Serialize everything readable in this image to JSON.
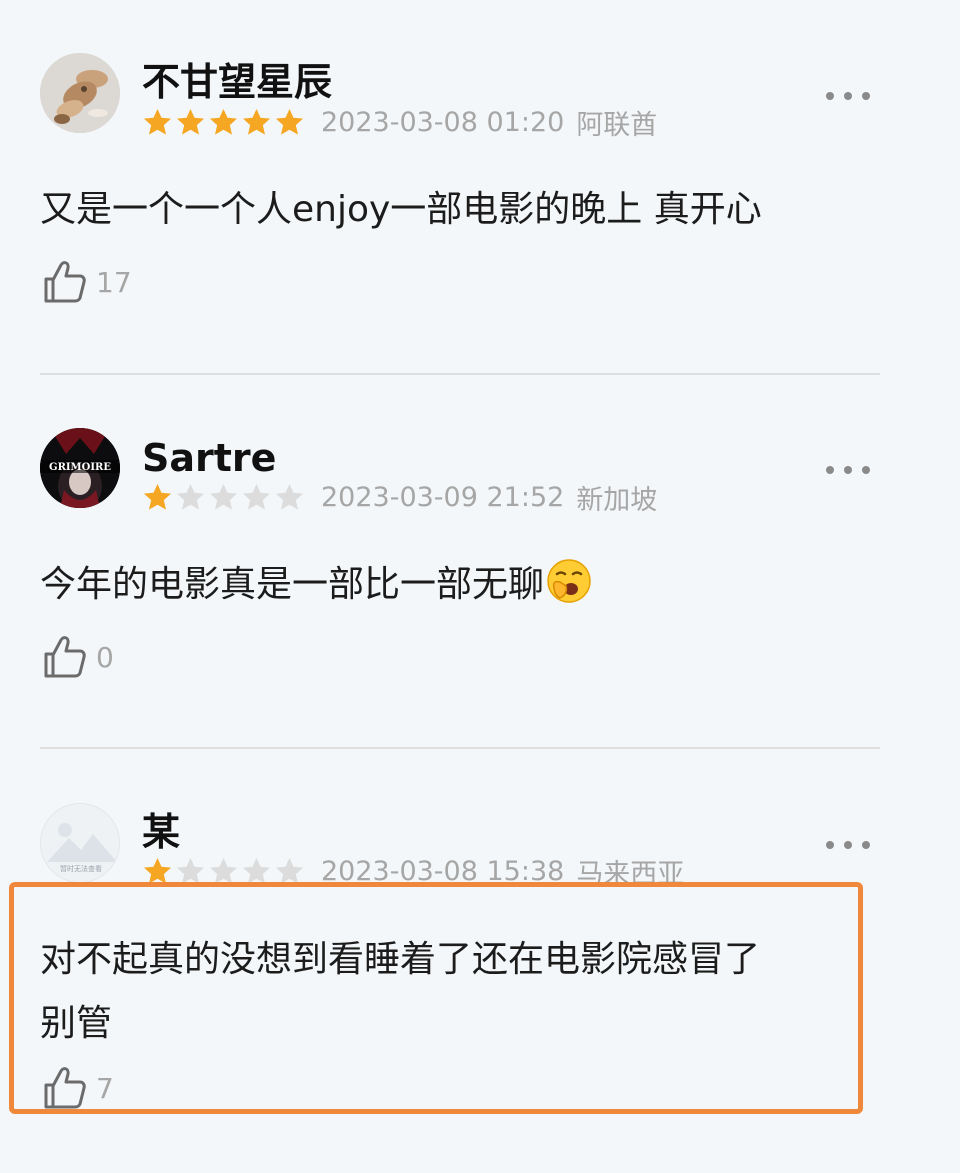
{
  "reviews": [
    {
      "username": "不甘望星辰",
      "rating": 5,
      "rating_max": 5,
      "datetime": "2023-03-08 01:20",
      "location": "阿联酋",
      "content": "又是一个一个人enjoy一部电影的晚上 真开心",
      "likes": "17",
      "avatar_icon": "cat-photo-avatar"
    },
    {
      "username": "Sartre",
      "rating": 1,
      "rating_max": 5,
      "datetime": "2023-03-09 21:52",
      "location": "新加坡",
      "content": "今年的电影真是一部比一部无聊",
      "content_emoji": "yawning-face-emoji",
      "likes": "0",
      "avatar_icon": "grimoire-avatar",
      "avatar_text": "GRIMOIRE"
    },
    {
      "username": "某",
      "rating": 1,
      "rating_max": 5,
      "datetime": "2023-03-08 15:38",
      "location": "马来西亚",
      "content_lines": [
        "对不起真的没想到看睡着了还在电影院感冒了",
        "别管"
      ],
      "likes": "7",
      "avatar_icon": "placeholder-mountain-avatar",
      "avatar_text": "暂时无法查看"
    }
  ],
  "icons": {
    "more": "more-dots-icon",
    "like": "thumbs-up-icon",
    "star": "star-icon"
  },
  "colors": {
    "star_filled": "#f5a623",
    "star_empty": "#dcdcdc",
    "meta_text": "#a6a6a6",
    "highlight_border": "#f0883c",
    "background": "#f4f7f9"
  }
}
